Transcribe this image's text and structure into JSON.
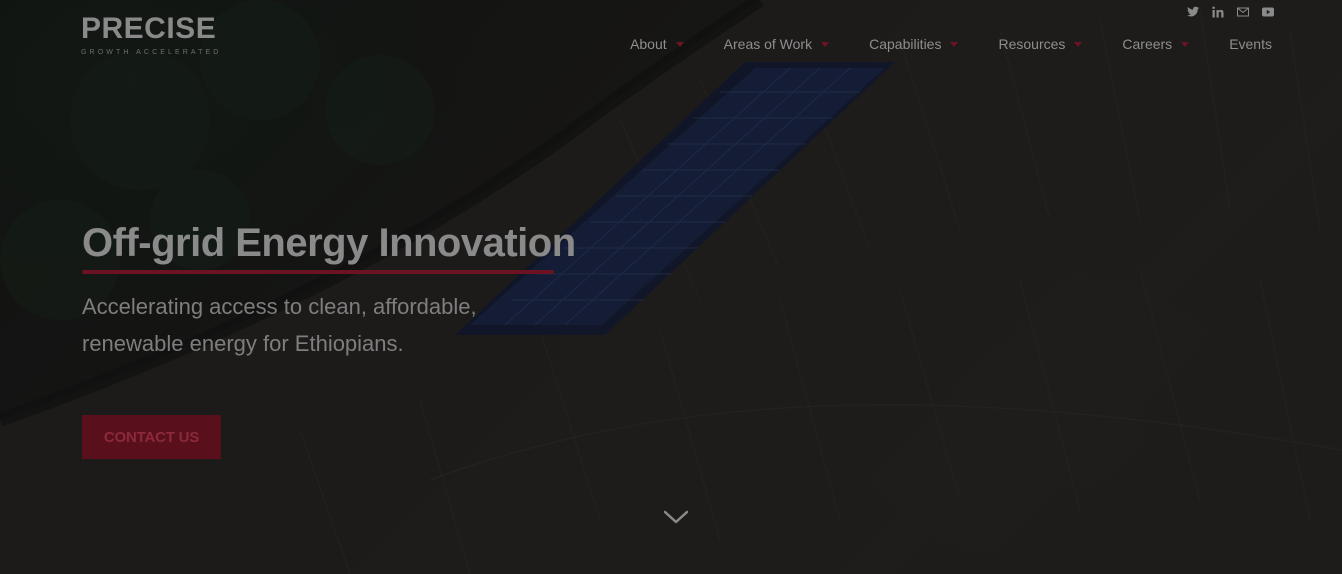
{
  "header": {
    "logo": {
      "word": "PRECISE",
      "tagline": "GROWTH ACCELERATED"
    },
    "social": [
      {
        "icon": "twitter-icon"
      },
      {
        "icon": "linkedin-icon"
      },
      {
        "icon": "mail-icon"
      },
      {
        "icon": "youtube-icon"
      }
    ],
    "nav": [
      {
        "label": "About",
        "has_dropdown": true
      },
      {
        "label": "Areas of Work",
        "has_dropdown": true
      },
      {
        "label": "Capabilities",
        "has_dropdown": true
      },
      {
        "label": "Resources",
        "has_dropdown": true
      },
      {
        "label": "Careers",
        "has_dropdown": true
      },
      {
        "label": "Events",
        "has_dropdown": false
      }
    ]
  },
  "hero": {
    "title": "Off-grid Energy Innovation",
    "subtitle": "Accelerating access to clean, affordable, renewable energy for Ethiopians.",
    "cta_label": "CONTACT US",
    "scroll_icon": "chevron-down-icon"
  },
  "colors": {
    "accent": "#6b1322",
    "cta_bg": "#5a0f1c",
    "text_muted": "#8a8a8a"
  }
}
